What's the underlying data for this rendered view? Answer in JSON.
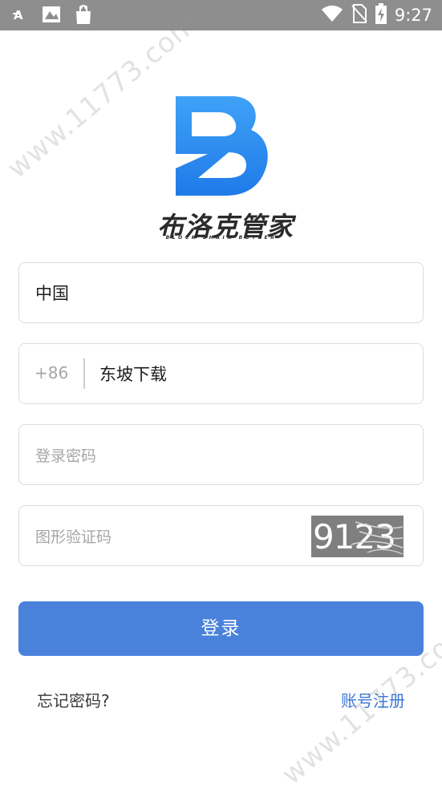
{
  "status_bar": {
    "time": "9:27",
    "icons": [
      "font-icon",
      "image-icon",
      "shopping-bag-icon",
      "wifi-icon",
      "no-sim-icon",
      "battery-charging-icon"
    ]
  },
  "logo": {
    "name": "布洛克管家",
    "subtitle": "BLOCK CHAIN BUTLER",
    "color": "#2f8bf0"
  },
  "form": {
    "country_value": "中国",
    "phone_prefix": "+86",
    "phone_value": "东坡下载",
    "password_placeholder": "登录密码",
    "captcha_placeholder": "图形验证码",
    "captcha_image_text": "9123"
  },
  "actions": {
    "login_label": "登录",
    "forgot_label": "忘记密码?",
    "register_label": "账号注册"
  },
  "watermark": {
    "text": "www.11773.com"
  },
  "colors": {
    "accent": "#4a82db",
    "link": "#3b77d6",
    "status_bar": "#8e8e8e"
  }
}
